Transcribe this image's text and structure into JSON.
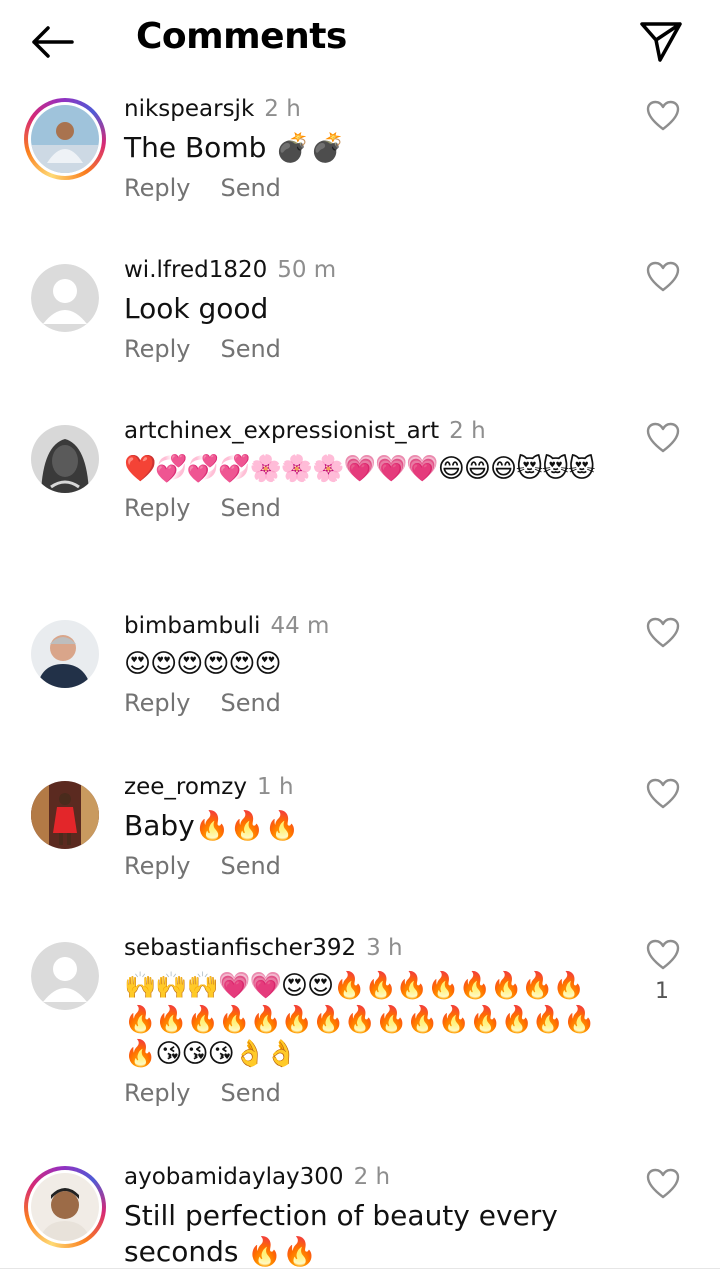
{
  "header": {
    "title": "Comments"
  },
  "actions": {
    "reply": "Reply",
    "send": "Send"
  },
  "comments": [
    {
      "username": "nikspearsjk",
      "time": "2 h",
      "text": "The Bomb 💣💣",
      "likes": ""
    },
    {
      "username": "wi.lfred1820",
      "time": "50 m",
      "text": "Look good",
      "likes": ""
    },
    {
      "username": "artchinex_expressionist_art",
      "time": "2 h",
      "text": "❤️💞💞💞🌸🌸🌸💗💗💗😄😄😄😻😻😻",
      "likes": ""
    },
    {
      "username": "bimbambuli",
      "time": "44 m",
      "text": "😍😍😍😍😍😍",
      "likes": ""
    },
    {
      "username": "zee_romzy",
      "time": "1 h",
      "text": "Baby🔥🔥🔥",
      "likes": ""
    },
    {
      "username": "sebastianfischer392",
      "time": "3 h",
      "text": "🙌🙌🙌💗💗😍😍🔥🔥🔥🔥🔥🔥🔥🔥🔥🔥🔥🔥🔥🔥🔥🔥🔥🔥🔥🔥🔥🔥🔥🔥😘😘😘👌👌",
      "likes": "1"
    },
    {
      "username": "ayobamidaylay300",
      "time": "2 h",
      "text": "Still perfection of beauty every seconds 🔥🔥",
      "likes": ""
    }
  ],
  "colors": {
    "muted": "#8e8e8e",
    "action": "#737373",
    "text": "#111111"
  }
}
